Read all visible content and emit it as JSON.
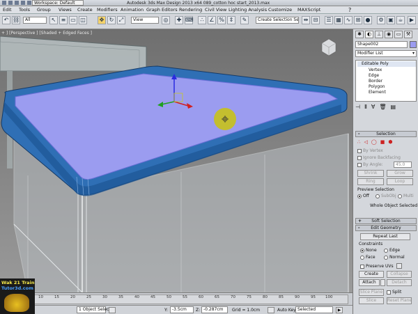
{
  "titlebar": {
    "workspace": "Workspace: Default",
    "title": "Autodesk 3ds Max Design 2013 x64     089_cotton hoc start_2013.max"
  },
  "menu": [
    "Edit",
    "Tools",
    "Group",
    "Views",
    "Create",
    "Modifiers",
    "Animation",
    "Graph Editors",
    "Rendering",
    "Civil View",
    "Lighting Analysis",
    "Customize",
    "MAXScript"
  ],
  "toolbar": {
    "filter": "All",
    "refcoord": "View",
    "selset": "Create Selection Se"
  },
  "viewport": {
    "label": "+ ] [Perspective ] [Shaded + Edged Faces ]"
  },
  "panel": {
    "object_name": "Shape002",
    "modifier_list": "Modifier List",
    "stack_root": "Editable Poly",
    "stack_items": [
      "Vertex",
      "Edge",
      "Border",
      "Polygon",
      "Element"
    ],
    "selection": {
      "title": "Selection",
      "by_vertex": "By Vertex",
      "ignore_backfacing": "Ignore Backfacing",
      "by_angle": "By Angle:",
      "angle_value": "45.0",
      "shrink": "Shrink",
      "grow": "Grow",
      "ring": "Ring",
      "loop": "Loop",
      "preview_label": "Preview Selection",
      "preview_off": "Off",
      "preview_subobj": "SubObj",
      "preview_multi": "Multi",
      "status": "Whole Object Selected"
    },
    "soft_selection": "Soft Selection",
    "edit_geometry": {
      "title": "Edit Geometry",
      "repeat_last": "Repeat Last",
      "constraints": "Constraints",
      "none": "None",
      "edge": "Edge",
      "face": "Face",
      "normal": "Normal",
      "preserve_uvs": "Preserve UVs",
      "create": "Create",
      "collapse": "Collapse",
      "attach": "Attach",
      "detach": "Detach",
      "slice_plane": "Slice Plane",
      "split": "Split",
      "slice": "Slice",
      "reset_plane": "Reset Plane"
    }
  },
  "timeline": {
    "ticks": [
      "10",
      "15",
      "20",
      "25",
      "30",
      "35",
      "40",
      "45",
      "50",
      "55",
      "60",
      "65",
      "70",
      "75",
      "80",
      "85",
      "90",
      "95",
      "100"
    ]
  },
  "statusbar": {
    "objects": "1 Object Selec",
    "y_label": "Y:",
    "y_value": "-3.5cm",
    "z_label": "Z:",
    "z_value": "-0.287cm",
    "grid": "Grid = 1.0cm",
    "autokey": "Auto Key",
    "selected": "Selected"
  },
  "watermark": {
    "line1": "Wak 21 Training",
    "line2": "Tutor3d.com"
  }
}
